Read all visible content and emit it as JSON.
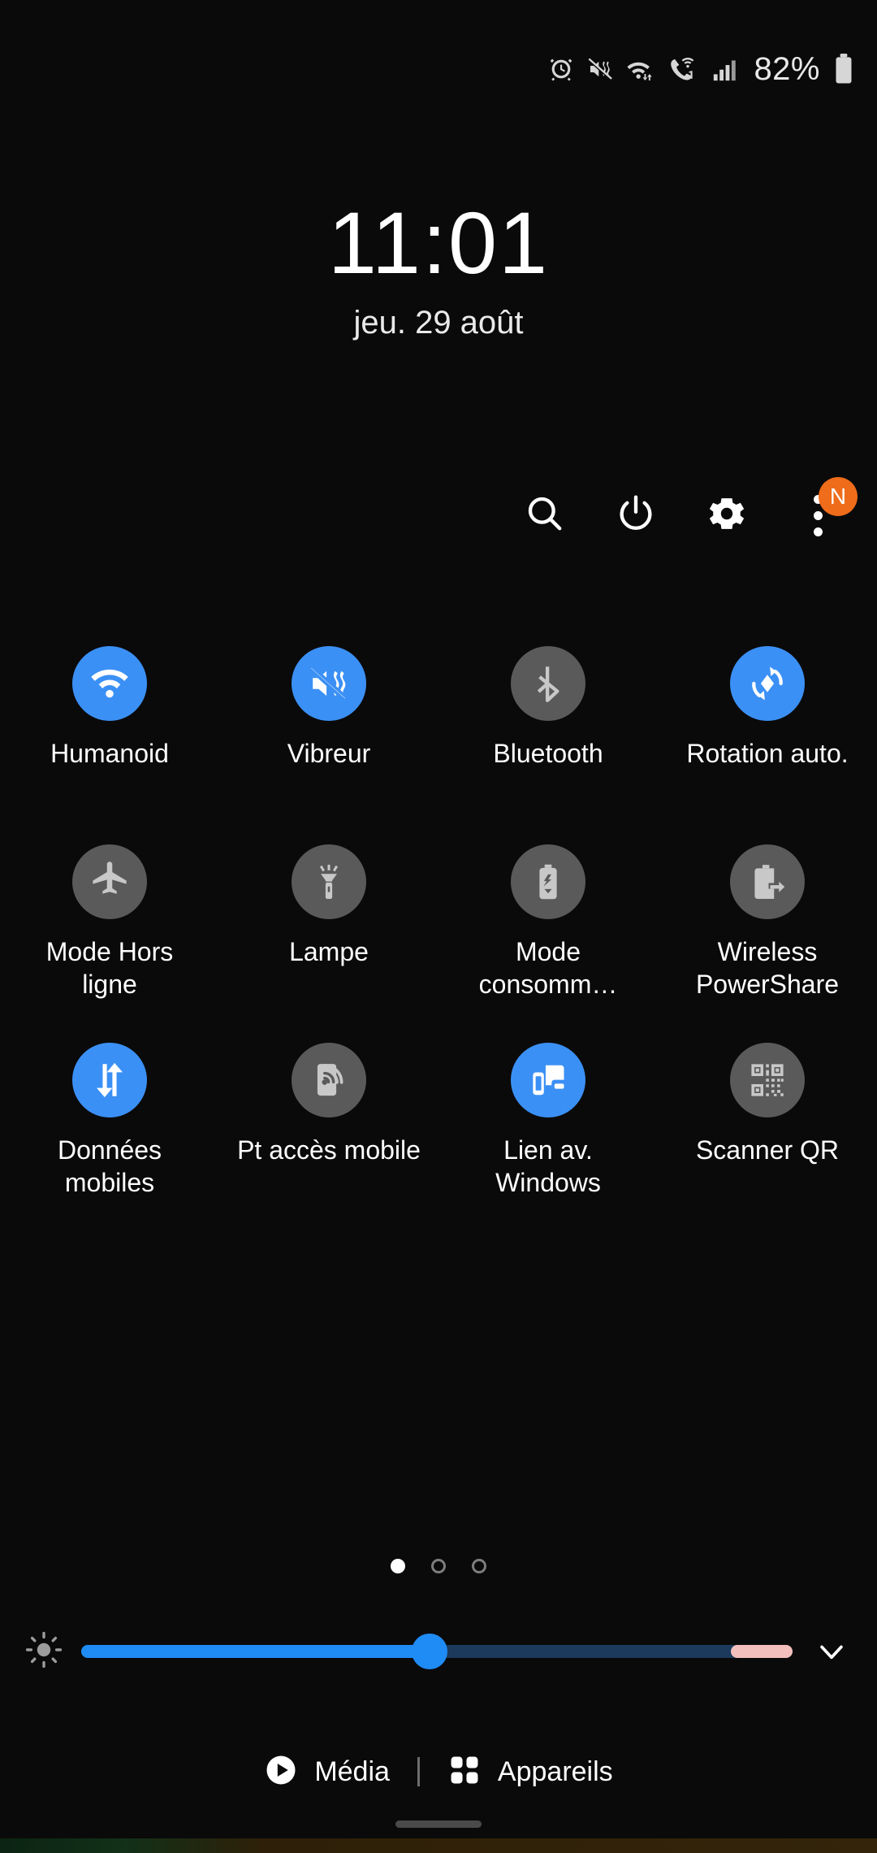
{
  "status_bar": {
    "battery_percent": "82%",
    "icons": [
      "alarm-icon",
      "vibrate-mute-icon",
      "wifi-data-icon",
      "wifi-calling-icon",
      "signal-bars-icon",
      "battery-icon"
    ]
  },
  "clock": {
    "time": "11:01",
    "date": "jeu. 29 août"
  },
  "actions": {
    "search_label": "search-icon",
    "power_label": "power-icon",
    "settings_label": "gear-icon",
    "more_label": "more-options-icon",
    "badge_text": "N"
  },
  "tiles": [
    {
      "label": "Humanoid",
      "icon": "wifi-icon",
      "state": "on"
    },
    {
      "label": "Vibreur",
      "icon": "vibrate-icon",
      "state": "on"
    },
    {
      "label": "Bluetooth",
      "icon": "bluetooth-icon",
      "state": "off"
    },
    {
      "label": "Rotation auto.",
      "icon": "auto-rotate-icon",
      "state": "on"
    },
    {
      "label": "Mode Hors ligne",
      "icon": "airplane-icon",
      "state": "off"
    },
    {
      "label": "Lampe",
      "icon": "flashlight-icon",
      "state": "off"
    },
    {
      "label": "Mode consomm…",
      "icon": "power-saving-icon",
      "state": "off"
    },
    {
      "label": "Wireless PowerShare",
      "icon": "power-share-icon",
      "state": "off"
    },
    {
      "label": "Données mobiles",
      "icon": "mobile-data-icon",
      "state": "on"
    },
    {
      "label": "Pt accès mobile",
      "icon": "hotspot-icon",
      "state": "off"
    },
    {
      "label": "Lien av. Windows",
      "icon": "link-to-windows-icon",
      "state": "on"
    },
    {
      "label": "Scanner QR",
      "icon": "qr-scanner-icon",
      "state": "off"
    }
  ],
  "pager": {
    "total": 3,
    "active_index": 0
  },
  "brightness": {
    "value_percent": 49,
    "icon": "brightness-icon",
    "expand_icon": "chevron-down-icon"
  },
  "bottom_bar": {
    "media_label": "Média",
    "devices_label": "Appareils"
  },
  "colors": {
    "accent_on": "#3b90f5",
    "tile_off": "#5a5a5a",
    "badge": "#ef6c1a",
    "slider_fill": "#1f8bf5",
    "slider_tail": "#f3bfbd",
    "background": "#0a0a0a"
  }
}
